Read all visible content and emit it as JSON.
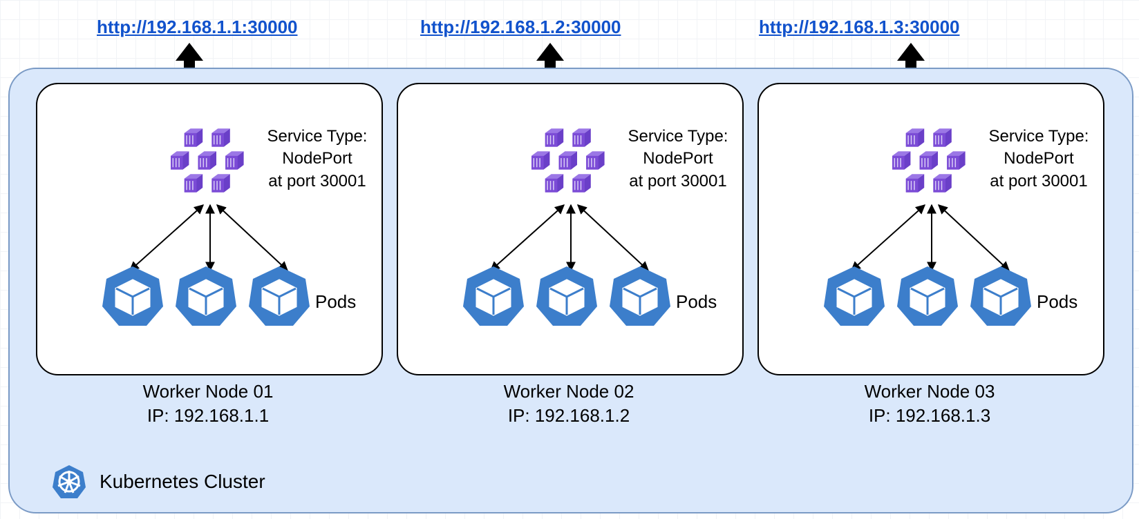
{
  "cluster": {
    "label": "Kubernetes Cluster"
  },
  "nodes": [
    {
      "url": "http://192.168.1.1:30000",
      "service_line1": "Service Type:",
      "service_line2": "NodePort",
      "service_line3": "at port 30001",
      "pods_label": "Pods",
      "name": "Worker Node 01",
      "ip": "IP: 192.168.1.1"
    },
    {
      "url": "http://192.168.1.2:30000",
      "service_line1": "Service Type:",
      "service_line2": "NodePort",
      "service_line3": "at port 30001",
      "pods_label": "Pods",
      "name": "Worker Node 02",
      "ip": "IP: 192.168.1.2"
    },
    {
      "url": "http://192.168.1.3:30000",
      "service_line1": "Service Type:",
      "service_line2": "NodePort",
      "service_line3": "at port 30001",
      "pods_label": "Pods",
      "name": "Worker Node 03",
      "ip": "IP: 192.168.1.3"
    }
  ],
  "colors": {
    "cluster_bg": "#dae8fb",
    "cluster_border": "#7a9ac5",
    "link": "#1152cc",
    "container_purple": "#7b4bd6",
    "pod_blue": "#3c7ecb"
  }
}
